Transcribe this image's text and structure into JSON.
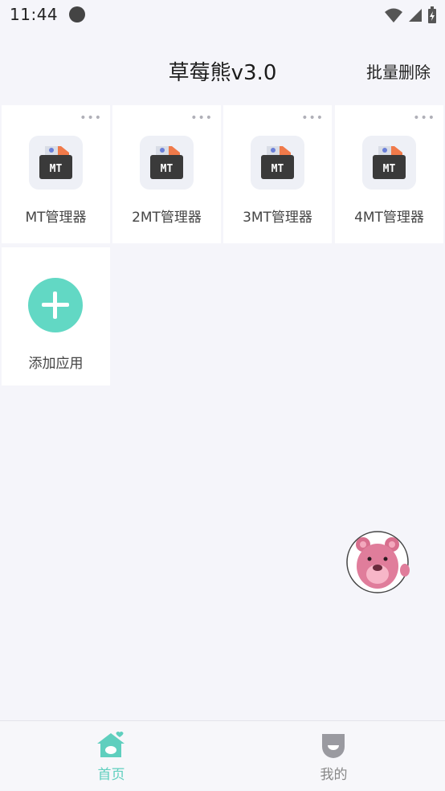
{
  "status_bar": {
    "time": "11:44"
  },
  "header": {
    "title": "草莓熊v3.0",
    "batch_delete": "批量删除"
  },
  "apps": [
    {
      "label": "MT管理器",
      "icon": "mt-icon"
    },
    {
      "label": "2MT管理器",
      "icon": "mt-icon"
    },
    {
      "label": "3MT管理器",
      "icon": "mt-icon"
    },
    {
      "label": "4MT管理器",
      "icon": "mt-icon"
    }
  ],
  "add_app": {
    "label": "添加应用",
    "icon": "plus-icon"
  },
  "more_glyph": "•••",
  "tabs": [
    {
      "label": "首页",
      "icon": "home-icon",
      "active": true
    },
    {
      "label": "我的",
      "icon": "profile-icon",
      "active": false
    }
  ],
  "colors": {
    "accent": "#5fcfbe",
    "add_button": "#62d8c4",
    "background": "#f5f5fa"
  }
}
